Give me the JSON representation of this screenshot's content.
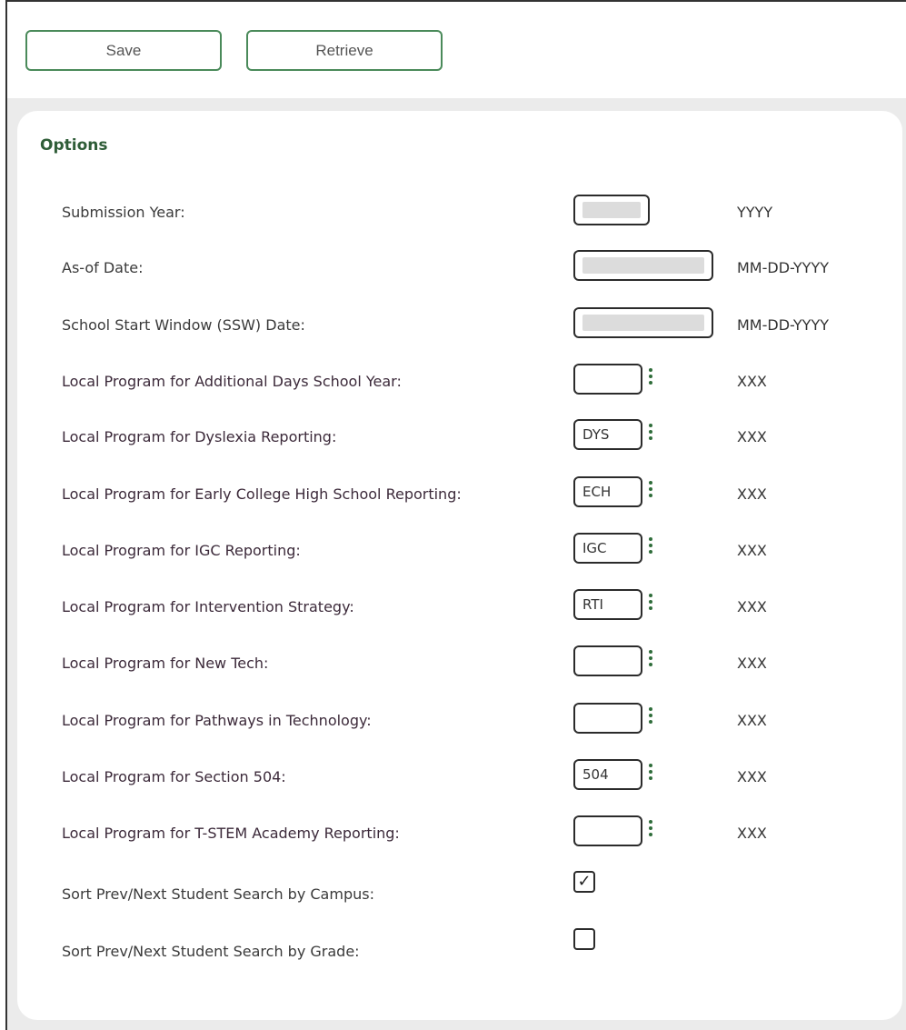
{
  "toolbar": {
    "save_label": "Save",
    "retrieve_label": "Retrieve"
  },
  "options": {
    "title": "Options",
    "submission_year": {
      "label": "Submission Year:",
      "format": "YYYY"
    },
    "as_of_date": {
      "label": "As-of Date:",
      "format": "MM-DD-YYYY"
    },
    "ssw_date": {
      "label": "School Start Window (SSW) Date:",
      "format": "MM-DD-YYYY"
    },
    "programs": [
      {
        "label": "Local Program for Additional Days School Year:",
        "value": "",
        "format": "XXX"
      },
      {
        "label": "Local Program for Dyslexia Reporting:",
        "value": "DYS",
        "format": "XXX"
      },
      {
        "label": "Local Program for Early College High School Reporting:",
        "value": "ECH",
        "format": "XXX"
      },
      {
        "label": "Local Program for IGC Reporting:",
        "value": "IGC",
        "format": "XXX"
      },
      {
        "label": "Local Program for Intervention Strategy:",
        "value": "RTI",
        "format": "XXX"
      },
      {
        "label": "Local Program for New Tech:",
        "value": "",
        "format": "XXX"
      },
      {
        "label": "Local Program for Pathways in Technology:",
        "value": "",
        "format": "XXX"
      },
      {
        "label": "Local Program for Section 504:",
        "value": "504",
        "format": "XXX"
      },
      {
        "label": "Local Program for T-STEM Academy Reporting:",
        "value": "",
        "format": "XXX"
      }
    ],
    "sort_by_campus": {
      "label": "Sort Prev/Next Student Search by Campus:",
      "checked": true,
      "mark": "✓"
    },
    "sort_by_grade": {
      "label": "Sort Prev/Next Student Search by Grade:",
      "checked": false,
      "mark": ""
    }
  }
}
